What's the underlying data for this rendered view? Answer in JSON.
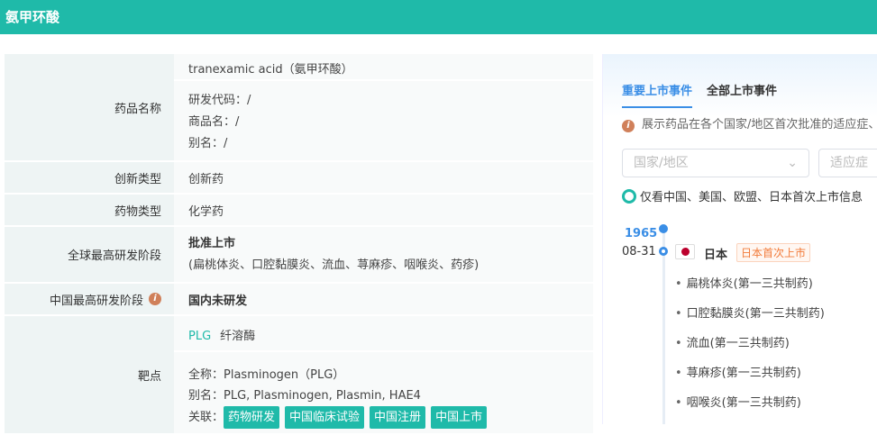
{
  "header": {
    "title": "氨甲环酸"
  },
  "table": {
    "name_label": "药品名称",
    "name_value": "tranexamic acid（氨甲环酸）",
    "code": "研发代码：/",
    "trade": "商品名：/",
    "alias": "别名：/",
    "innov_label": "创新类型",
    "innov_value": "创新药",
    "type_label": "药物类型",
    "type_value": "化学药",
    "global_label": "全球最高研发阶段",
    "global_value": "批准上市",
    "global_indications": "(扁桃体炎、口腔黏膜炎、流血、荨麻疹、咽喉炎、药疹)",
    "china_label": "中国最高研发阶段",
    "china_value": "国内未研发",
    "target_label": "靶点",
    "target_code": "PLG",
    "target_name": "纤溶酶",
    "full_name": "全称：Plasminogen（PLG）",
    "target_alias": "别名：PLG, Plasminogen, Plasmin, HAE4",
    "related_label": "关联：",
    "related_tags": [
      "药物研发",
      "中国临床试验",
      "中国注册",
      "中国上市"
    ]
  },
  "panel": {
    "tabs": [
      "重要上市事件",
      "全部上市事件"
    ],
    "note": "展示药品在各个国家/地区首次批准的适应症、",
    "country_placeholder": "国家/地区",
    "indication_placeholder": "适应症",
    "radio_label": "仅看中国、美国、欧盟、日本首次上市信息",
    "year": "1965",
    "date": "08-31",
    "country": "日本",
    "badge": "日本首次上市",
    "items": [
      "扁桃体炎(第一三共制药)",
      "口腔黏膜炎(第一三共制药)",
      "流血(第一三共制药)",
      "荨麻疹(第一三共制药)",
      "咽喉炎(第一三共制药)"
    ]
  }
}
